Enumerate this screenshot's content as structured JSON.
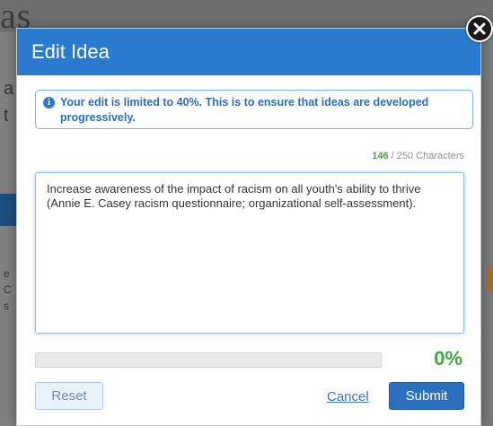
{
  "background": {
    "logo_fragment": "as",
    "left_glyphs": [
      "a",
      "t",
      "e",
      "C",
      "s"
    ]
  },
  "modal": {
    "title": "Edit Idea",
    "close_icon": "close-x-icon",
    "info": {
      "icon": "info-circle-icon",
      "message": "Your edit is limited to 40%. This is to ensure that ideas are developed progressively."
    },
    "char_count": {
      "current": "146",
      "separator": " / ",
      "max_text": "250 Characters"
    },
    "idea_text": "Increase awareness of the impact of racism on all youth's ability to thrive (Annie E. Casey racism questionnaire; organizational self-assessment).",
    "progress": {
      "fraction": 0.0,
      "label": "0%"
    },
    "buttons": {
      "reset": "Reset",
      "cancel": "Cancel",
      "submit": "Submit"
    }
  },
  "colors": {
    "header_blue": "#2a7bd0",
    "accent_green": "#3fa93f",
    "submit_blue": "#2a6fc0"
  }
}
